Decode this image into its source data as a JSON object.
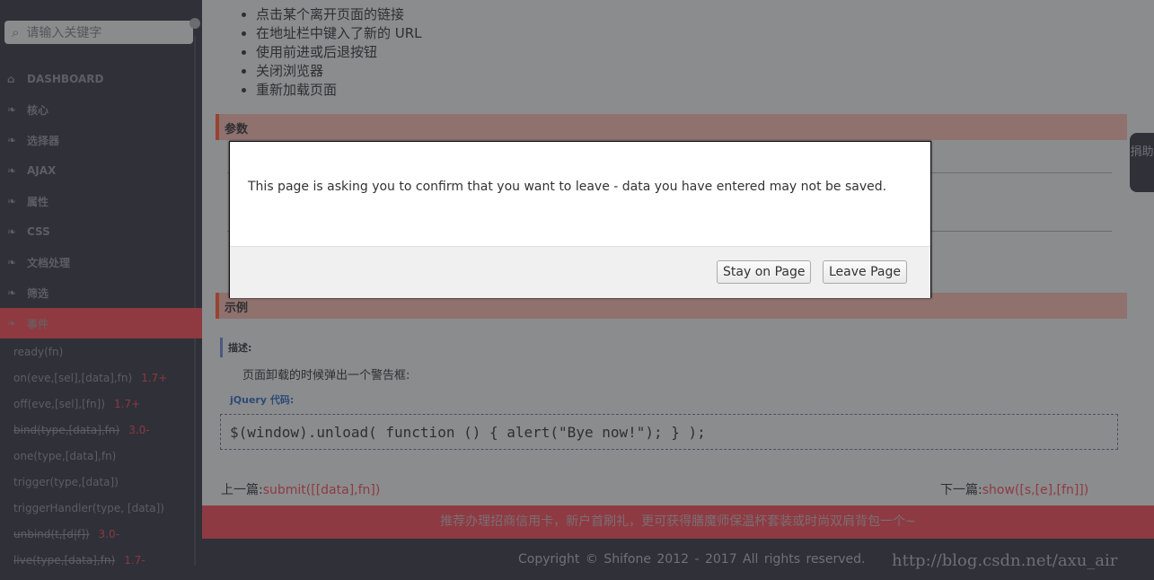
{
  "sidebar": {
    "search_placeholder": "请输入关键字",
    "dashboard": "DASHBOARD",
    "items": [
      "核心",
      "选择器",
      "AJAX",
      "属性",
      "CSS",
      "文档处理",
      "筛选",
      "事件"
    ],
    "active_item": "事件",
    "sub_items": [
      {
        "label": "ready(fn)",
        "version": "",
        "deprecated": false
      },
      {
        "label": "on(eve,[sel],[data],fn)",
        "version": "1.7+",
        "deprecated": false
      },
      {
        "label": "off(eve,[sel],[fn])",
        "version": "1.7+",
        "deprecated": false
      },
      {
        "label": "bind(type,[data],fn)",
        "version": "3.0-",
        "deprecated": true
      },
      {
        "label": "one(type,[data],fn)",
        "version": "",
        "deprecated": false
      },
      {
        "label": "trigger(type,[data])",
        "version": "",
        "deprecated": false
      },
      {
        "label": "triggerHandler(type, [data])",
        "version": "",
        "deprecated": false
      },
      {
        "label": "unbind(t,[d|f])",
        "version": "3.0-",
        "deprecated": true
      },
      {
        "label": "live(type,[data],fn)",
        "version": "1.7-",
        "deprecated": true
      }
    ]
  },
  "main": {
    "bullets": [
      "点击某个离开页面的链接",
      "在地址栏中键入了新的 URL",
      "使用前进或后退按钮",
      "关闭浏览器",
      "重新加载页面"
    ],
    "params_heading": "参数",
    "example_heading": "示例",
    "desc_label": "描述:",
    "desc_text": "页面卸载的时候弹出一个警告框:",
    "code_label": "jQuery 代码:",
    "code": "$(window).unload( function () { alert(\"Bye now!\"); } );",
    "prev_label": "上一篇:",
    "prev_link": "submit([[data],fn])",
    "next_label": "下一篇:",
    "next_link": "show([s,[e],[fn]])",
    "promo": "推荐办理招商信用卡，新户首刷礼，更可获得膳魔师保温杯套装或时尚双肩背包一个~",
    "copyright": "Copyright © Shifone    2012 - 2017    All rights reserved.",
    "watermark": "http://blog.csdn.net/axu_air",
    "donate": "捐助"
  },
  "dialog": {
    "message": "This page is asking you to confirm that you want to leave - data you have entered may not be saved.",
    "stay_label": "Stay on Page",
    "leave_label": "Leave Page"
  },
  "colors": {
    "accent": "#c9414b",
    "sidebar": "#2f3038"
  }
}
